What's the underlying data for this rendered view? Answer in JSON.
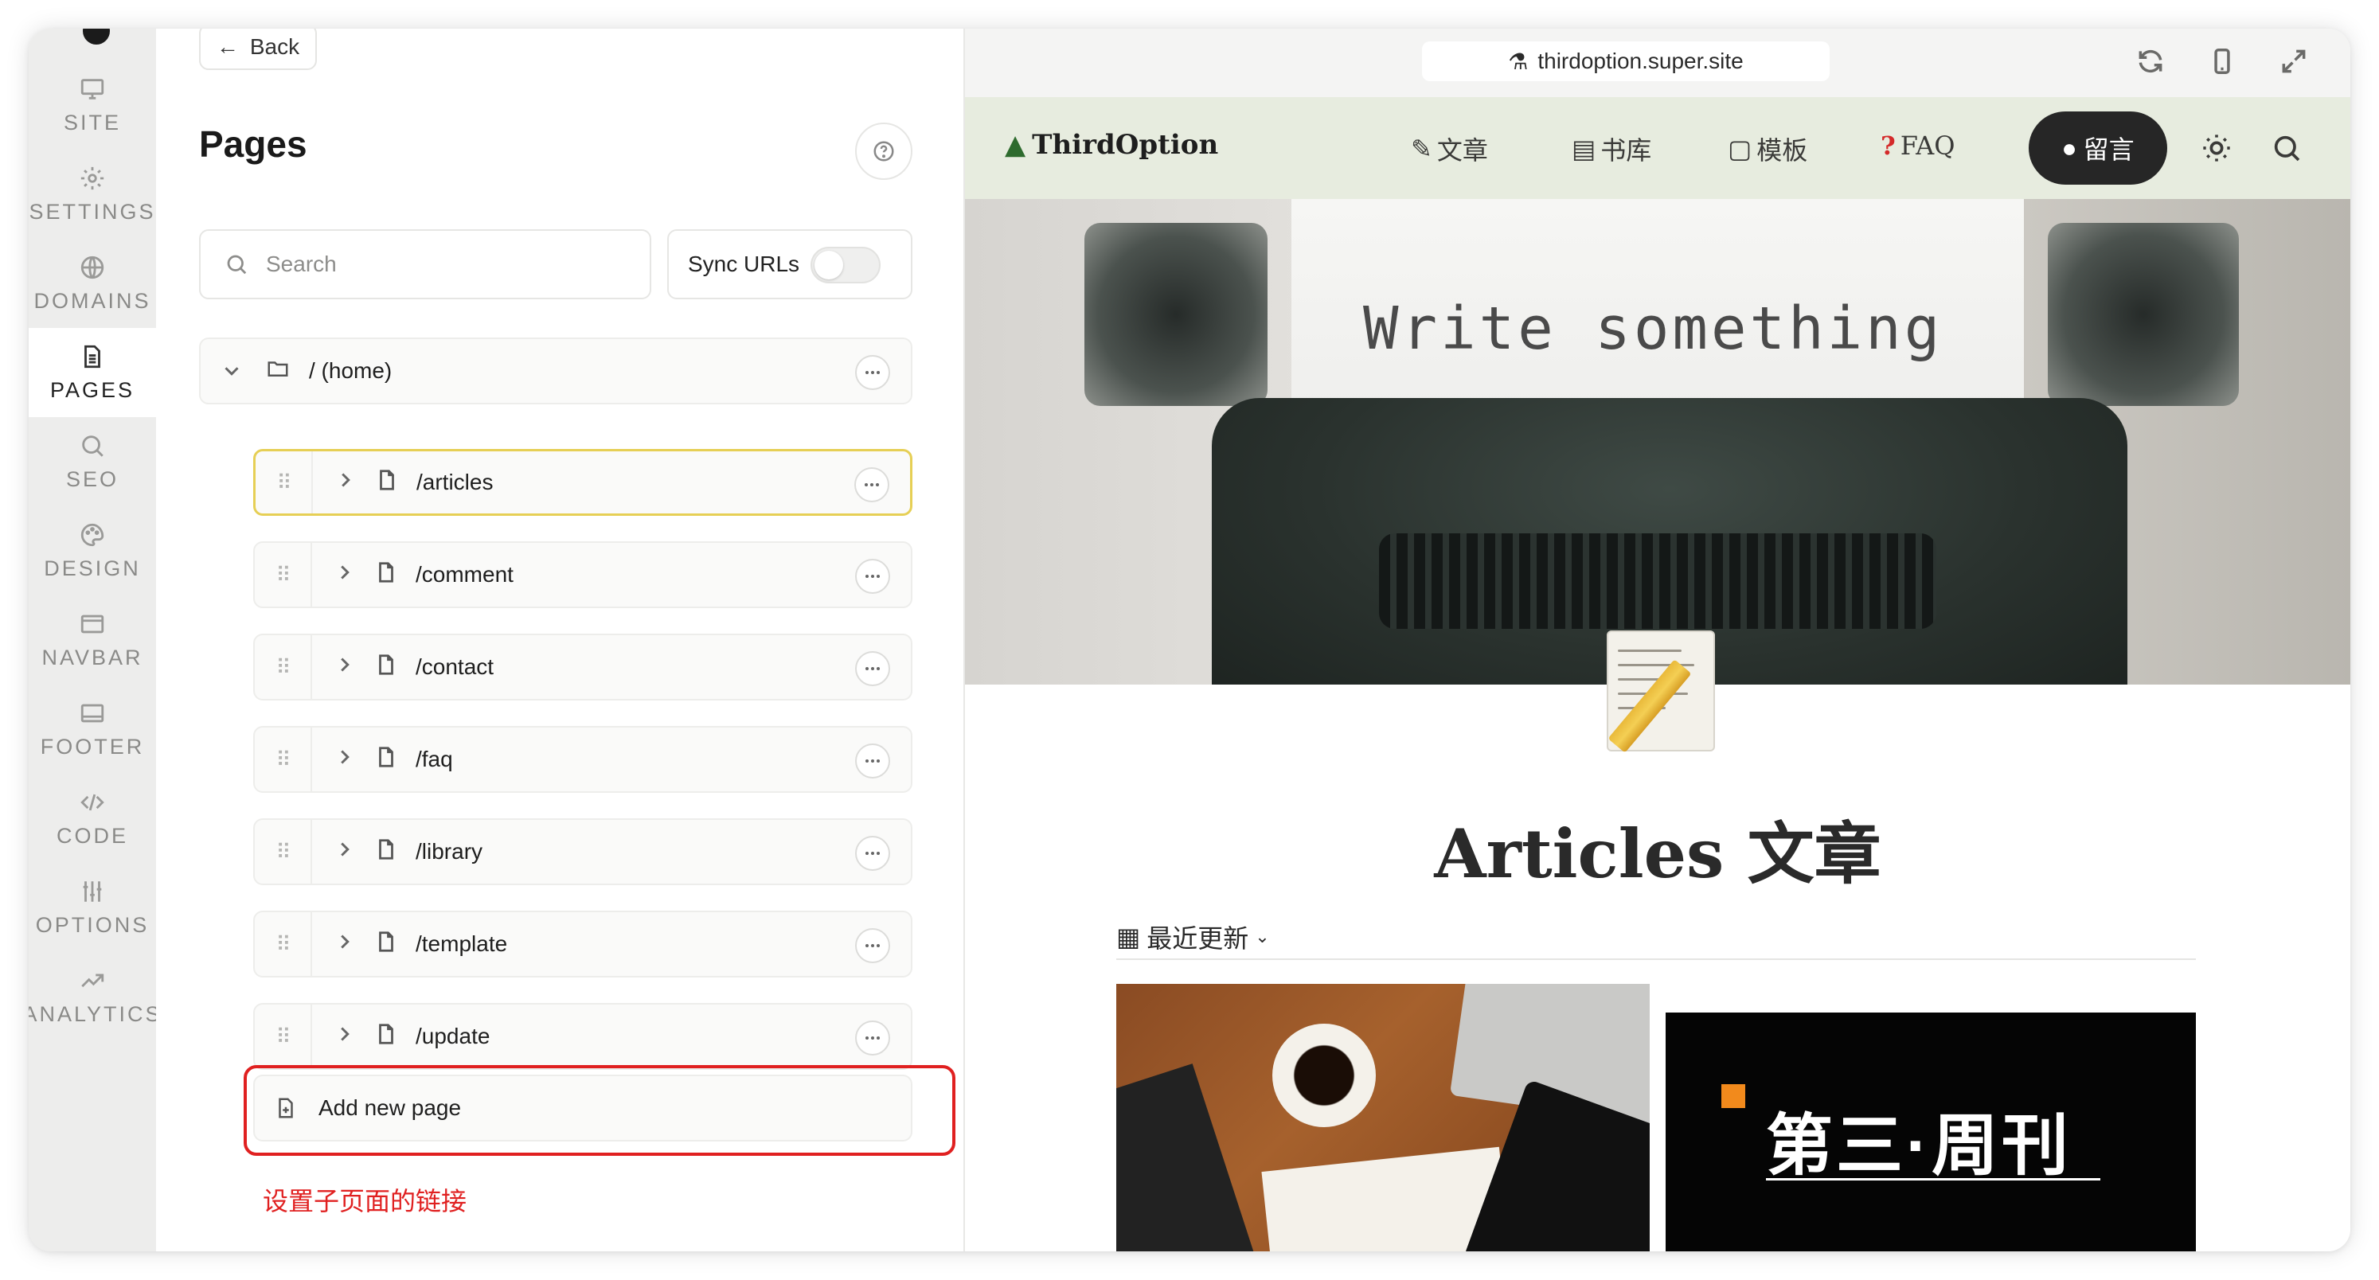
{
  "rail": {
    "items": [
      {
        "label": "SITE",
        "icon": "monitor-icon"
      },
      {
        "label": "SETTINGS",
        "icon": "gear-icon"
      },
      {
        "label": "DOMAINS",
        "icon": "globe-icon"
      },
      {
        "label": "PAGES",
        "icon": "document-icon",
        "active": true
      },
      {
        "label": "SEO",
        "icon": "search-icon"
      },
      {
        "label": "DESIGN",
        "icon": "palette-icon"
      },
      {
        "label": "NAVBAR",
        "icon": "navbar-icon"
      },
      {
        "label": "FOOTER",
        "icon": "footer-icon"
      },
      {
        "label": "CODE",
        "icon": "code-icon"
      },
      {
        "label": "OPTIONS",
        "icon": "sliders-icon"
      },
      {
        "label": "ANALYTICS",
        "icon": "trend-icon"
      }
    ]
  },
  "panel": {
    "back_label": "Back",
    "title": "Pages",
    "search_placeholder": "Search",
    "sync_label": "Sync URLs",
    "sync_enabled": false,
    "home_label": "/ (home)",
    "pages": [
      {
        "path": "/articles",
        "selected": true
      },
      {
        "path": "/comment"
      },
      {
        "path": "/contact"
      },
      {
        "path": "/faq"
      },
      {
        "path": "/library"
      },
      {
        "path": "/template"
      },
      {
        "path": "/update"
      }
    ],
    "add_page_label": "Add new page",
    "annotation": "设置子页面的链接",
    "annotation_color": "#e02020",
    "selected_border_color": "#e6cf55"
  },
  "preview": {
    "url": "thirdoption.super.site",
    "brand": "ThirdOption",
    "nav_links": [
      "文章",
      "书库",
      "模板",
      "FAQ"
    ],
    "cta": "留言",
    "hero_text": "Write something",
    "article_title": "Articles 文章",
    "filter_label": "最近更新",
    "card2_title": "第三·周刊",
    "nav_bg": "#e7ecdf",
    "cta_bg": "#262626"
  }
}
